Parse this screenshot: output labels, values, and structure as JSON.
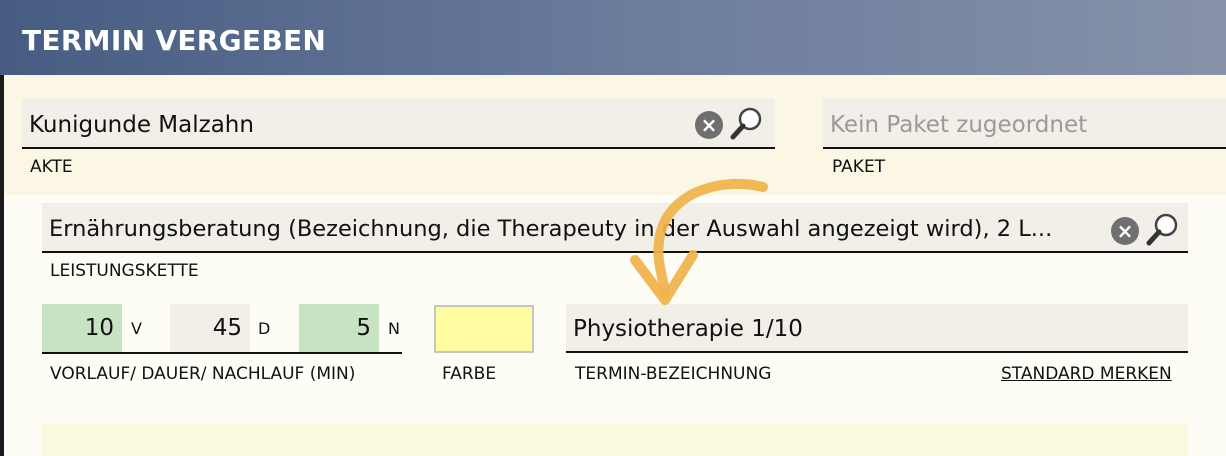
{
  "window": {
    "title": "TERMIN VERGEBEN"
  },
  "akte": {
    "value": "Kunigunde Malzahn",
    "caption": "AKTE"
  },
  "paket": {
    "placeholder": "Kein Paket zugeordnet",
    "caption": "PAKET"
  },
  "leistungskette": {
    "value": "Ernährungsberatung (Bezeichnung, die Therapeuty in der Auswahl angezeigt wird), 2 L...",
    "caption": "LEISTUNGSKETTE"
  },
  "timing": {
    "vorlauf": "10",
    "vorlauf_unit": "V",
    "dauer": "45",
    "dauer_unit": "D",
    "nachlauf": "5",
    "nachlauf_unit": "N",
    "caption": "VORLAUF/ DAUER/ NACHLAUF (MIN)"
  },
  "farbe": {
    "caption": "FARBE",
    "color": "#fdfca0"
  },
  "termin": {
    "value": "Physiotherapie 1/10",
    "caption": "TERMIN-BEZEICHNUNG",
    "link": "STANDARD MERKEN"
  },
  "colors": {
    "header": "#465c82",
    "field_bg": "#f1efe8",
    "green_field": "#c8e2c4",
    "arrow": "#f0b24a"
  },
  "icons": [
    "clear-icon",
    "search-icon",
    "arrow-annotation-icon"
  ]
}
